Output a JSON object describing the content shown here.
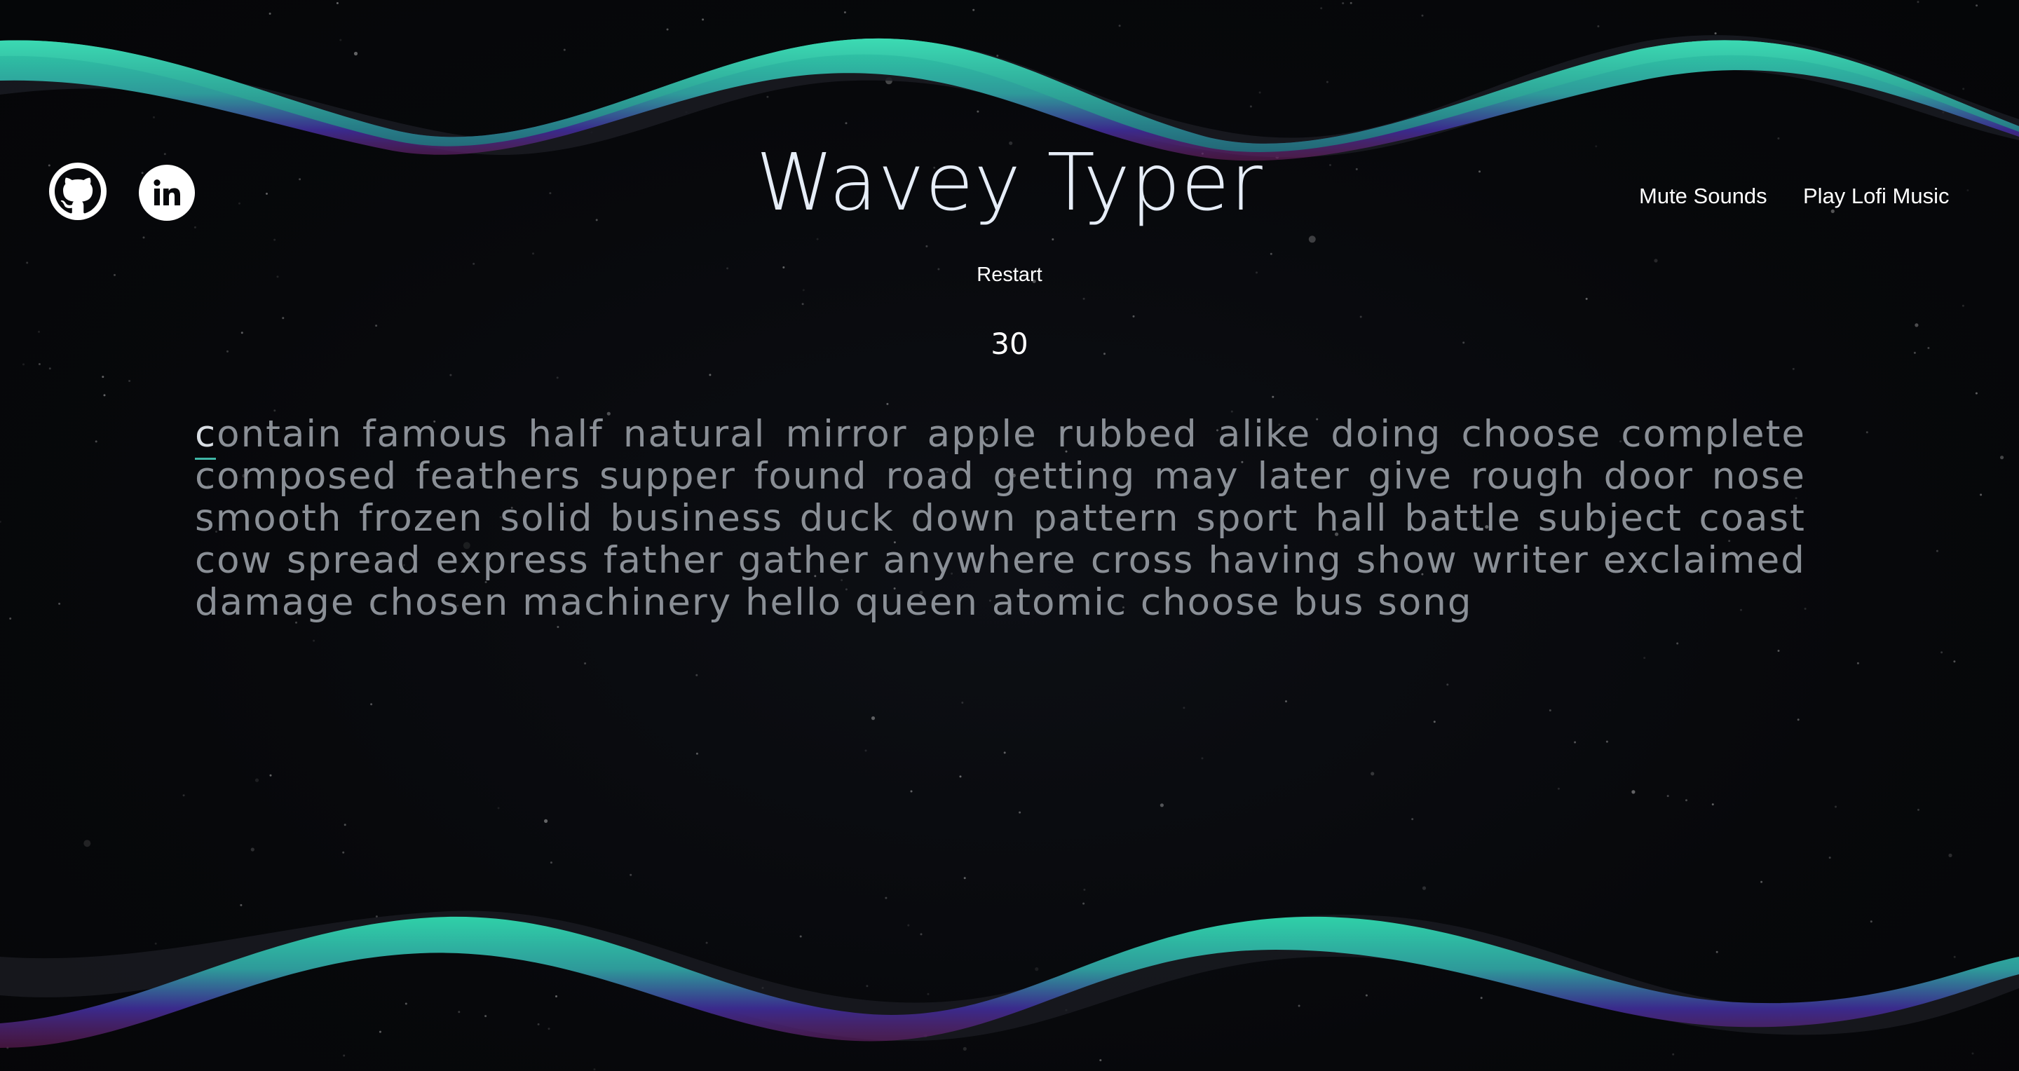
{
  "header": {
    "title": "Wavey Typer",
    "mute_label": "Mute Sounds",
    "lofi_label": "Play Lofi Music",
    "restart_label": "Restart"
  },
  "social": {
    "github_icon": "github-icon",
    "linkedin_icon": "linkedin-icon"
  },
  "timer": {
    "seconds": "30"
  },
  "typing": {
    "first_letter": "c",
    "first_word_rest": "ontain",
    "words": [
      "famous",
      "half",
      "natural",
      "mirror",
      "apple",
      "rubbed",
      "alike",
      "doing",
      "choose",
      "complete",
      "composed",
      "feathers",
      "supper",
      "found",
      "road",
      "getting",
      "may",
      "later",
      "give",
      "rough",
      "door",
      "nose",
      "smooth",
      "frozen",
      "solid",
      "business",
      "duck",
      "down",
      "pattern",
      "sport",
      "hall",
      "battle",
      "subject",
      "coast",
      "cow",
      "spread",
      "express",
      "father",
      "gather",
      "anywhere",
      "cross",
      "having",
      "show",
      "writer",
      "exclaimed",
      "damage",
      "chosen",
      "machinery",
      "hello",
      "queen",
      "atomic",
      "choose",
      "bus",
      "song"
    ]
  },
  "colors": {
    "background": "#07080b",
    "wave_teal": "#35c3a0",
    "wave_purple": "#3a2a8c",
    "wave_magenta": "#6a1f5e",
    "text_untyped": "#8a8f96",
    "text_title": "#e6edf7",
    "caret": "#3fb6a6"
  }
}
